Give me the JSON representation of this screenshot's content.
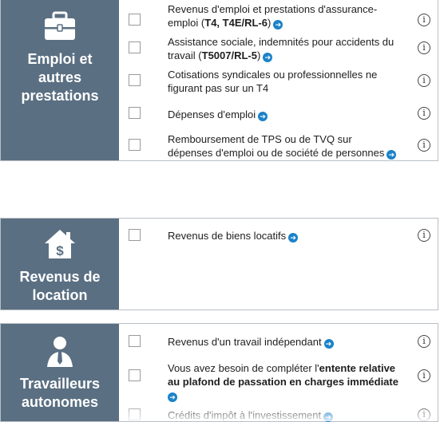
{
  "sections": [
    {
      "title": "Emploi et autres prestations",
      "icon": "briefcase-icon",
      "items": [
        {
          "pre": "Revenus d'emploi et prestations d'assurance-emploi (",
          "bold": "T4, T4E/RL-6",
          "post": ")"
        },
        {
          "pre": "Assistance sociale, indemnités pour accidents du travail (",
          "bold": "T5007/RL-5",
          "post": ")"
        },
        {
          "pre": "Cotisations syndicales ou professionnelles ne figurant pas sur un T4",
          "bold": "",
          "post": ""
        },
        {
          "pre": "Dépenses d'emploi",
          "bold": "",
          "post": ""
        },
        {
          "pre": "Remboursement de TPS ou de TVQ sur dépenses d'emploi ou de société de personnes",
          "bold": "",
          "post": ""
        }
      ]
    },
    {
      "title": "Revenus de location",
      "icon": "house-dollar-icon",
      "items": [
        {
          "pre": "Revenus de biens locatifs",
          "bold": "",
          "post": ""
        }
      ]
    },
    {
      "title": "Travailleurs autonomes",
      "icon": "person-tie-icon",
      "items": [
        {
          "pre": "Revenus d'un travail indépendant",
          "bold": "",
          "post": ""
        },
        {
          "pre": "Vous avez besoin de compléter l'",
          "bold": "entente relative au plafond de passation en charges immédiate",
          "post": ""
        },
        {
          "pre": "Crédits d'impôt à l'investissement",
          "bold": "",
          "post": ""
        }
      ]
    }
  ],
  "colors": {
    "sidebar": "#5a6f82",
    "link_arrow": "#1a82c8",
    "border": "#b9bfc6"
  },
  "info_glyph": "i",
  "arrow_glyph": "➔"
}
